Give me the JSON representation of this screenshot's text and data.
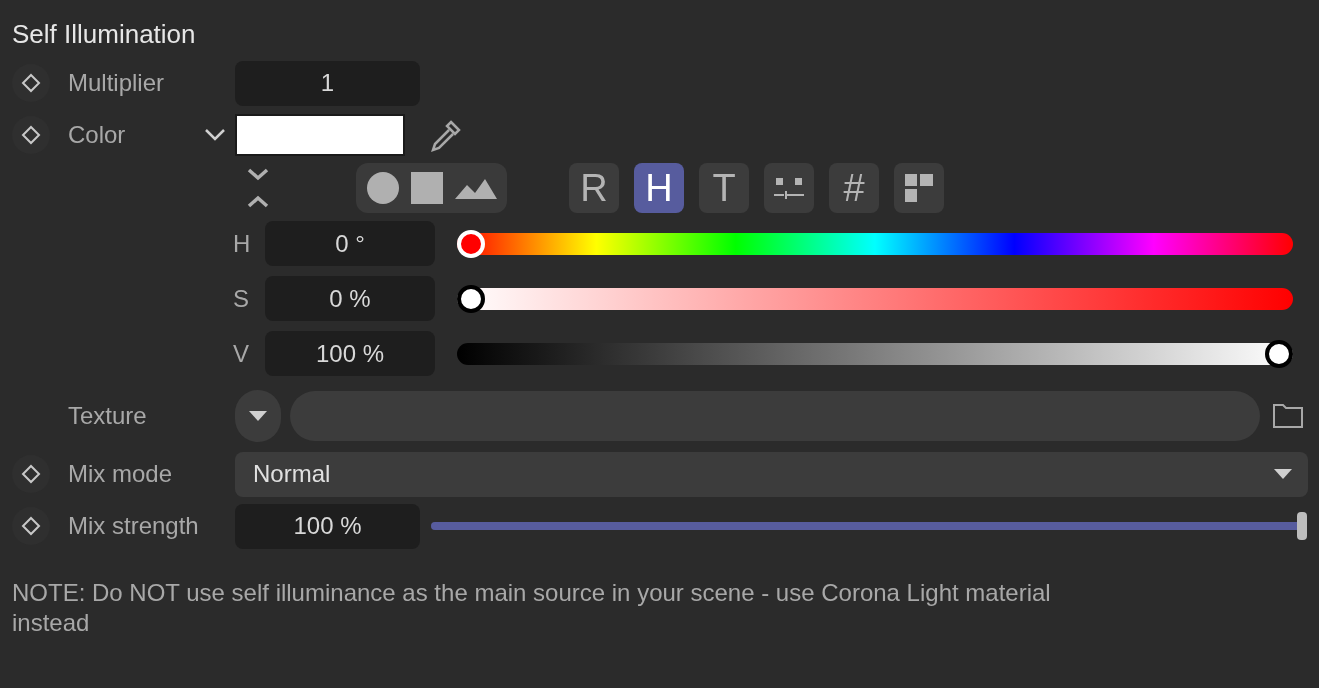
{
  "title": "Self Illumination",
  "multiplier": {
    "label": "Multiplier",
    "value": "1"
  },
  "color": {
    "label": "Color"
  },
  "modes": [
    {
      "kind": "letter",
      "label": "R",
      "selected": false
    },
    {
      "kind": "letter",
      "label": "H",
      "selected": true
    },
    {
      "kind": "letter",
      "label": "T",
      "selected": false
    },
    {
      "kind": "sliders",
      "selected": false
    },
    {
      "kind": "letter",
      "label": "#",
      "selected": false
    },
    {
      "kind": "swatches",
      "selected": false
    }
  ],
  "channels": [
    {
      "kind": "hue",
      "label": "H",
      "value": "0 °",
      "level": 0
    },
    {
      "kind": "saturation",
      "label": "S",
      "value": "0 %",
      "level": 0
    },
    {
      "kind": "value",
      "label": "V",
      "value": "100 %",
      "level": 1
    }
  ],
  "texture": {
    "label": "Texture"
  },
  "mix_mode": {
    "label": "Mix mode",
    "value": "Normal"
  },
  "mix_strength": {
    "label": "Mix strength",
    "value": "100 %",
    "level": 1
  },
  "note": "NOTE: Do NOT use self illuminance as the main source in your scene - use Corona Light material instead"
}
